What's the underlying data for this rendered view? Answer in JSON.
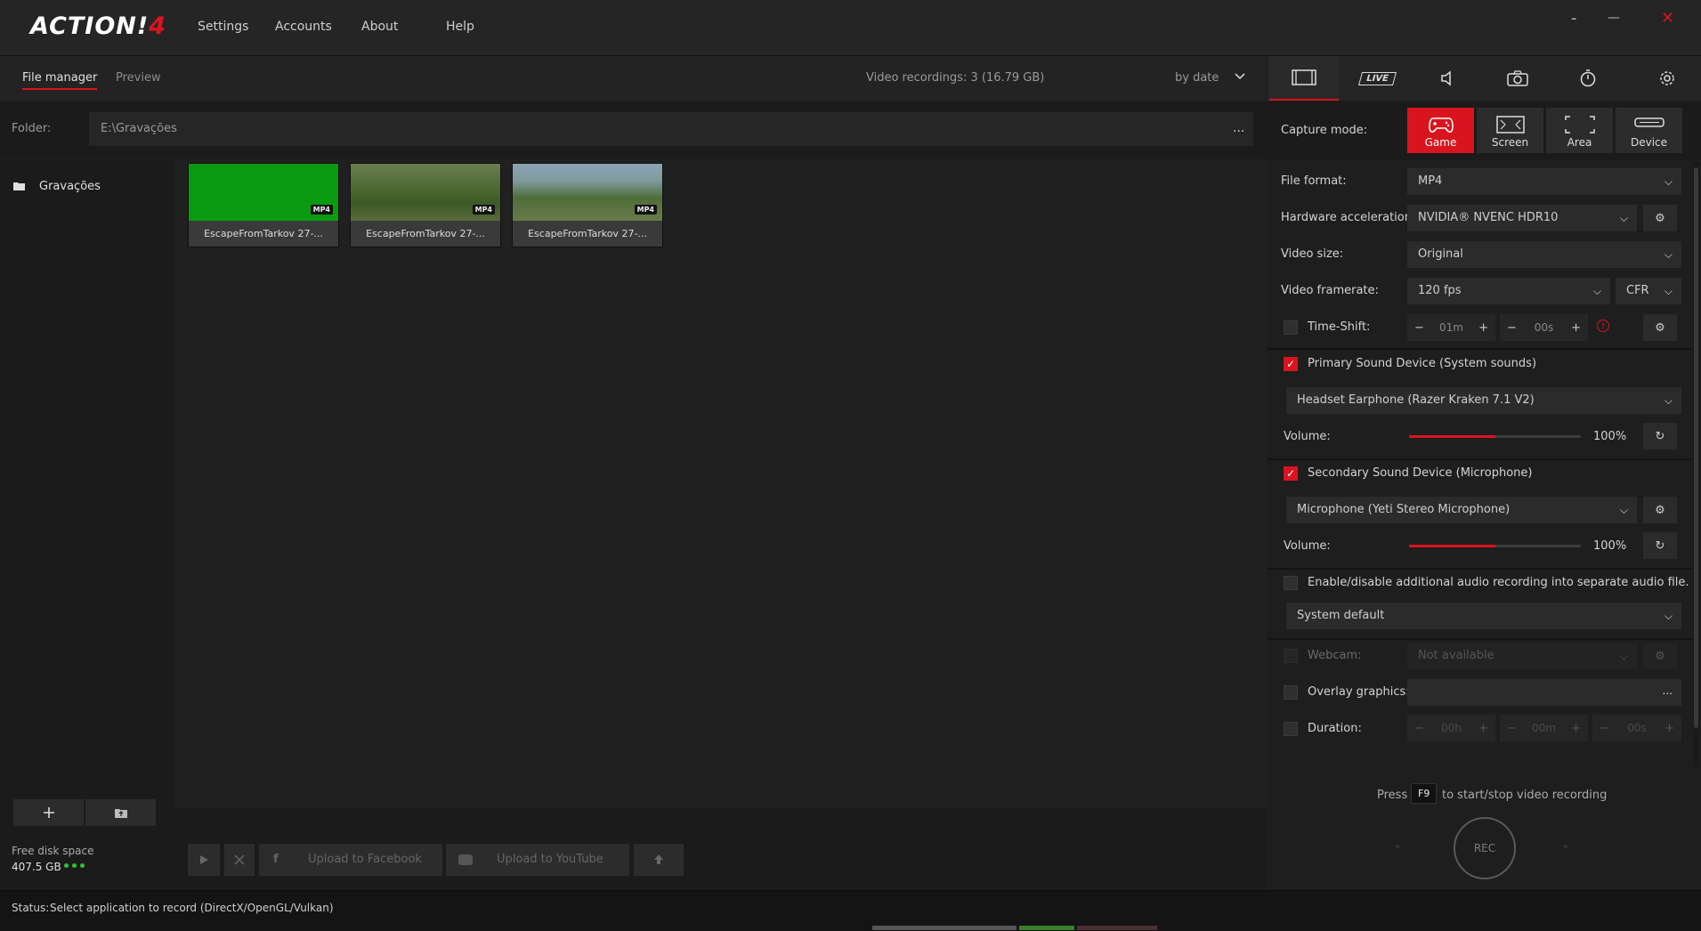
{
  "app": {
    "logo_main": "ACTION!",
    "logo_num": "4"
  },
  "menu": [
    "Settings",
    "Accounts",
    "About",
    "Help"
  ],
  "window": {
    "minimize": "-",
    "maximize": "—",
    "close": "✕"
  },
  "tabs": {
    "file_manager": "File manager",
    "preview": "Preview"
  },
  "recordings_count": "Video recordings: 3 (16.79 GB)",
  "sort": {
    "label": "by date"
  },
  "folder": {
    "label": "Folder:",
    "path": "E:\\Gravações",
    "browse": "..."
  },
  "sidebar": {
    "items": [
      {
        "label": "Gravações"
      }
    ],
    "free_space_label": "Free disk space",
    "free_space_value": "407.5 GB"
  },
  "thumbnails": [
    {
      "caption": "EscapeFromTarkov 27-...",
      "badge": "MP4"
    },
    {
      "caption": "EscapeFromTarkov 27-...",
      "badge": "MP4"
    },
    {
      "caption": "EscapeFromTarkov 27-...",
      "badge": "MP4"
    }
  ],
  "bottom": {
    "upload_facebook": "Upload to Facebook",
    "upload_youtube": "Upload to YouTube"
  },
  "status": {
    "label": "Status:",
    "text": "Select application to record  (DirectX/OpenGL/Vulkan)"
  },
  "right_tabs": [
    "video-icon",
    "live-icon",
    "audio-icon",
    "camera-icon",
    "timer-icon",
    "gear-icon"
  ],
  "live_label": "LIVE",
  "capture": {
    "label": "Capture mode:",
    "modes": [
      "Game",
      "Screen",
      "Area",
      "Device"
    ],
    "active": "Game"
  },
  "settings": {
    "file_format": {
      "label": "File format:",
      "value": "MP4"
    },
    "hw_accel": {
      "label": "Hardware acceleration:",
      "value": "NVIDIA® NVENC HDR10"
    },
    "video_size": {
      "label": "Video size:",
      "value": "Original"
    },
    "framerate": {
      "label": "Video framerate:",
      "value": "120 fps",
      "mode": "CFR"
    },
    "timeshift": {
      "label": "Time-Shift:",
      "min": "01m",
      "sec": "00s",
      "checked": false
    },
    "primary_sound": {
      "label": "Primary Sound Device (System sounds)",
      "checked": true,
      "device": "Headset Earphone (Razer Kraken 7.1 V2)",
      "volume_label": "Volume:",
      "volume": "100%",
      "level": 0.5
    },
    "secondary_sound": {
      "label": "Secondary Sound Device (Microphone)",
      "checked": true,
      "device": "Microphone (Yeti Stereo Microphone)",
      "volume_label": "Volume:",
      "volume": "100%",
      "level": 0.5
    },
    "additional_audio": {
      "label": "Enable/disable additional audio recording into separate audio file.",
      "checked": false,
      "device": "System default"
    },
    "webcam": {
      "label": "Webcam:",
      "value": "Not available",
      "checked": false
    },
    "overlay": {
      "label": "Overlay graphics:",
      "value": "",
      "browse": "...",
      "checked": false
    },
    "duration": {
      "label": "Duration:",
      "h": "00h",
      "m": "00m",
      "s": "00s",
      "checked": false
    }
  },
  "rec": {
    "press": "Press",
    "key": "F9",
    "hint": "to start/stop video recording",
    "button": "REC"
  },
  "colors": {
    "accent": "#d9141e",
    "bg": "#1e1e1e"
  }
}
